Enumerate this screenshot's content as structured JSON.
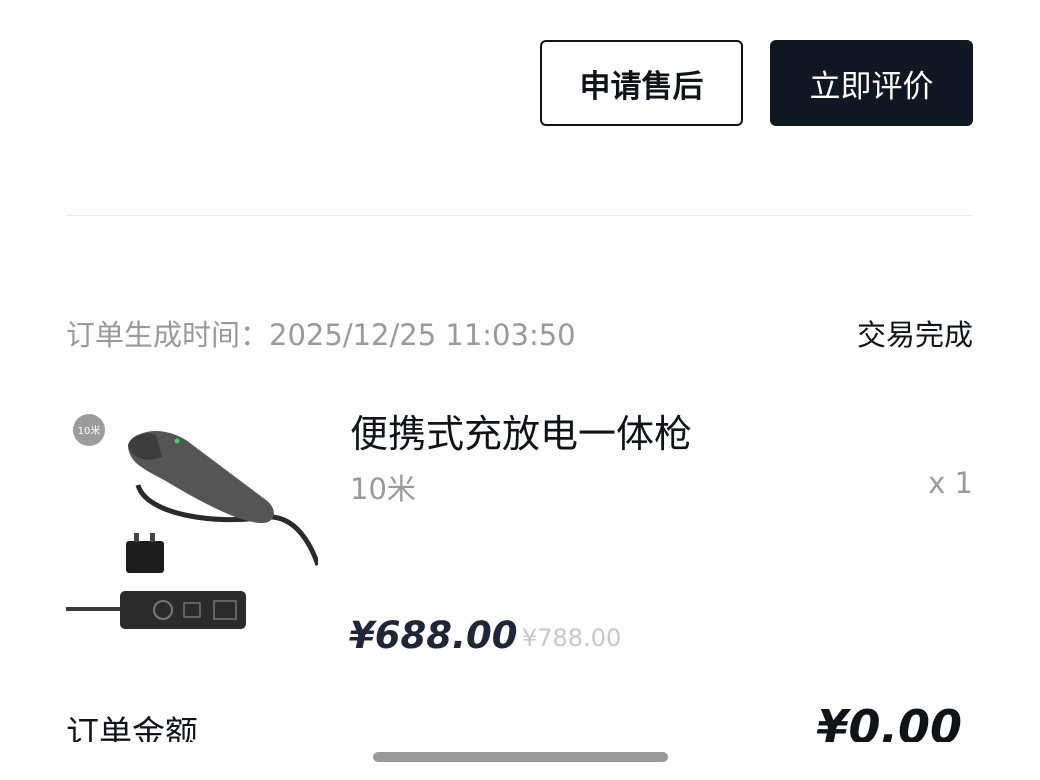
{
  "actions": {
    "after_sales_label": "申请售后",
    "review_label": "立即评价"
  },
  "order": {
    "time_label": "订单生成时间：",
    "time_value": "2025/12/25 11:03:50",
    "status": "交易完成"
  },
  "product": {
    "image_badge": "10米",
    "title": "便携式充放电一体枪",
    "spec": "10米",
    "quantity": "x 1",
    "price": "¥688.00",
    "original_price": "¥788.00"
  },
  "summary": {
    "amount_label": "订单金额",
    "amount_value": "¥0.00"
  },
  "colors": {
    "primary_button_bg": "#111722",
    "text_primary": "#111318",
    "text_secondary": "#9a9a9a",
    "price": "#1f2637",
    "original_price": "#c8c8c8"
  }
}
